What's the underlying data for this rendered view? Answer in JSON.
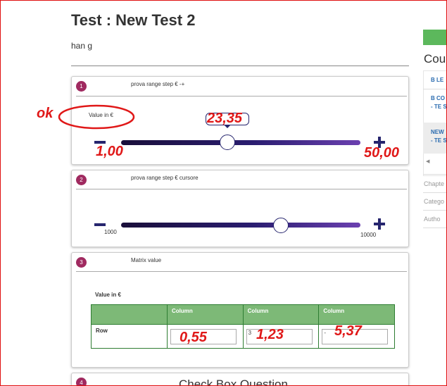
{
  "page": {
    "title": "Test : New Test 2",
    "subtitle": "han g"
  },
  "questions": [
    {
      "number": "1",
      "title": "prova range step € -+",
      "label": "Value in €",
      "slider_value_fraction": 0.457,
      "tooltip_value": "23,35",
      "min_annotation": "1,00",
      "max_annotation": "50,00",
      "annotation_ok": "ok"
    },
    {
      "number": "2",
      "title": "prova range step € cursore",
      "min_label": "1000",
      "max_label": "10000",
      "slider_value_fraction": 0.669
    },
    {
      "number": "3",
      "title": "Matrix value",
      "label": "Value in €",
      "columns": [
        "Column",
        "Column",
        "Column"
      ],
      "row_label": "Row",
      "cell_values": [
        "",
        "3",
        "-"
      ],
      "annotations": [
        "0,55",
        "1,23",
        "5,37"
      ]
    },
    {
      "number": "4",
      "title": "Check Box Question"
    }
  ],
  "sidebar": {
    "heading": "Cou",
    "links": [
      {
        "lines": [
          "B LE"
        ]
      },
      {
        "lines": [
          "B CO",
          "- TE S"
        ]
      },
      {
        "lines": [
          "NEW",
          "- TE S"
        ]
      }
    ],
    "scroll_left": "◀",
    "meta": [
      "Chapte",
      "Catego",
      "Autho"
    ]
  }
}
